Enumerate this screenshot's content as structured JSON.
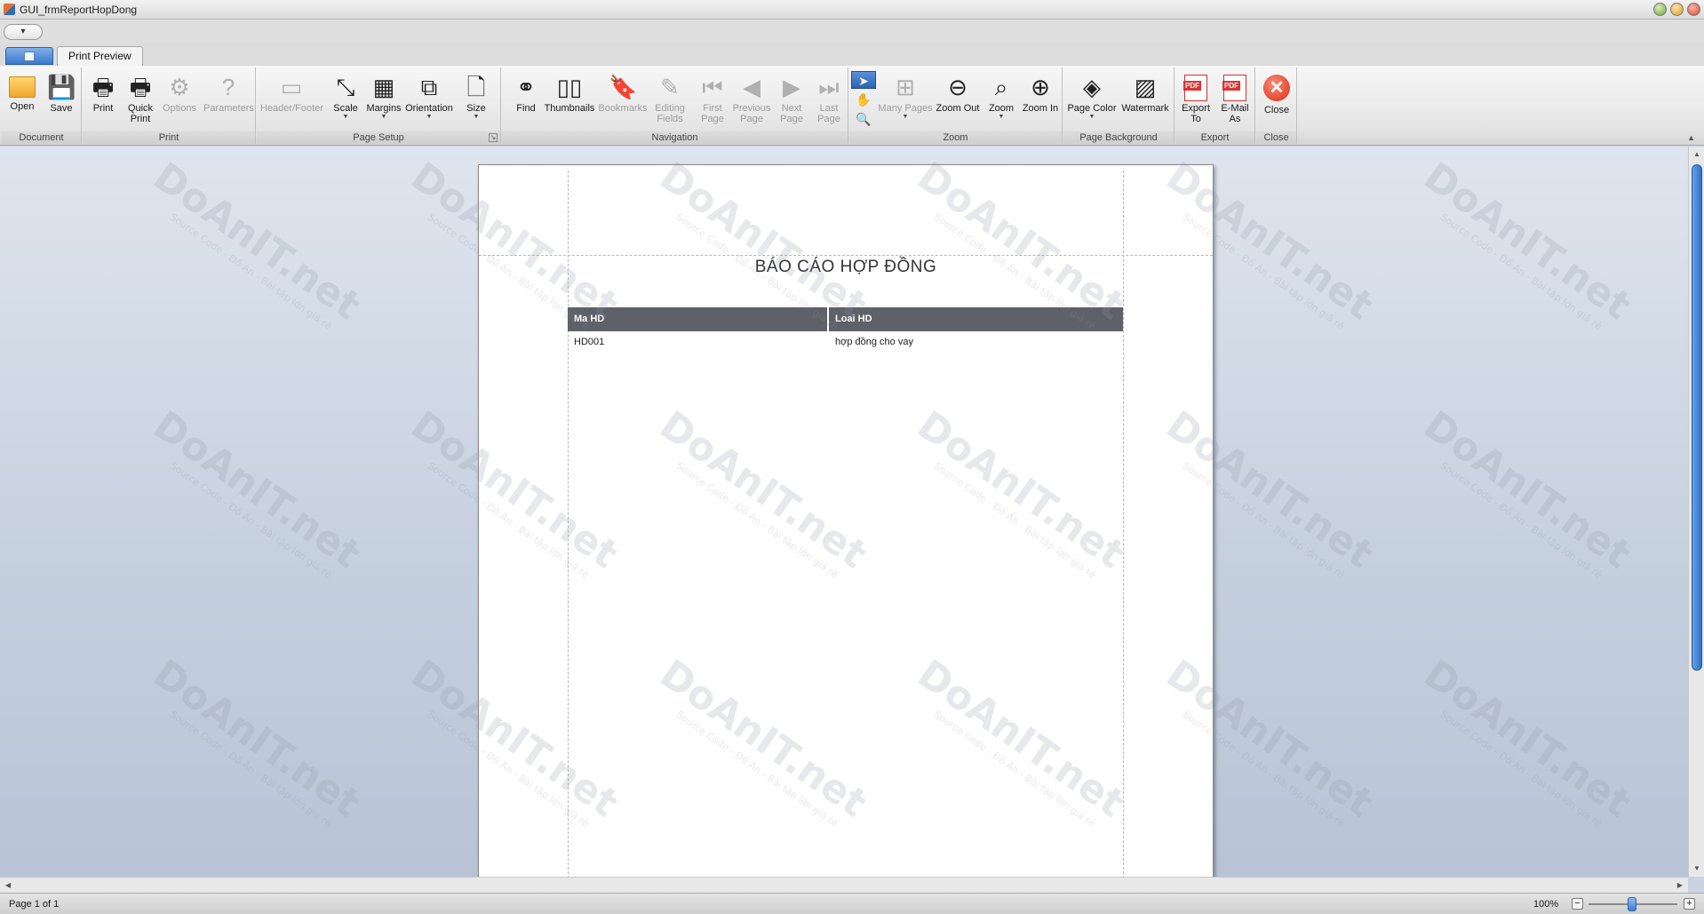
{
  "window": {
    "title": "GUI_frmReportHopDong"
  },
  "tabs": {
    "active": "Print Preview"
  },
  "ribbon": {
    "groups": {
      "document": "Document",
      "print": "Print",
      "page_setup": "Page Setup",
      "navigation": "Navigation",
      "zoom": "Zoom",
      "page_background": "Page Background",
      "export": "Export",
      "close": "Close"
    },
    "buttons": {
      "open": "Open",
      "save": "Save",
      "print": "Print",
      "quick_print_1": "Quick",
      "quick_print_2": "Print",
      "options": "Options",
      "parameters": "Parameters",
      "header_footer": "Header/Footer",
      "scale": "Scale",
      "margins": "Margins",
      "orientation": "Orientation",
      "size": "Size",
      "find": "Find",
      "thumbnails": "Thumbnails",
      "bookmarks": "Bookmarks",
      "editing_fields_1": "Editing",
      "editing_fields_2": "Fields",
      "first_page_1": "First",
      "first_page_2": "Page",
      "previous_page_1": "Previous",
      "previous_page_2": "Page",
      "next_page_1": "Next",
      "next_page_2": "Page",
      "last_page_1": "Last",
      "last_page_2": "Page",
      "many_pages": "Many Pages",
      "zoom_out": "Zoom Out",
      "zoom": "Zoom",
      "zoom_in": "Zoom In",
      "page_color": "Page Color",
      "watermark": "Watermark",
      "export_to_1": "Export",
      "export_to_2": "To",
      "email_as_1": "E-Mail",
      "email_as_2": "As",
      "close": "Close"
    }
  },
  "report": {
    "title": "BÁO CÁO HỢP ĐỒNG",
    "columns": [
      "Ma HD",
      "Loai HD"
    ],
    "rows": [
      [
        "HD001",
        "hợp đồng cho vay"
      ]
    ]
  },
  "watermark": {
    "brand": "DoAnIT.net",
    "tagline": "Source Code - Đồ Án - Bài tập lớn giá rẻ"
  },
  "status": {
    "page_info": "Page 1 of 1",
    "zoom_level": "100%"
  }
}
